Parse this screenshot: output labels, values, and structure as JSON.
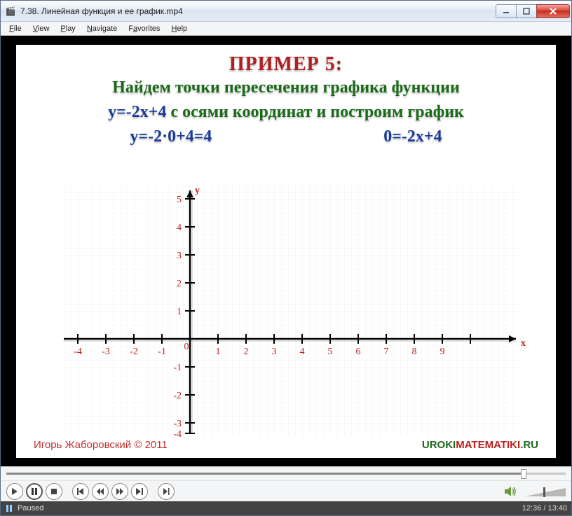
{
  "window": {
    "title": "7.38. Линейная функция и ее график.mp4"
  },
  "menu": {
    "file": "File",
    "view": "View",
    "play": "Play",
    "navigate": "Navigate",
    "favorites": "Favorites",
    "help": "Help"
  },
  "slide": {
    "title": "ПРИМЕР 5:",
    "line1_green": "Найдем точки пересечения графика функции",
    "line2_blue": "y=-2x+4",
    "line2_green": " с осями координат и построим график",
    "calc_left": "y=-2·0+4=4",
    "calc_right": "0=-2x+4",
    "author": "Игорь Жаборовский © 2011",
    "site_part1": "UROKI",
    "site_part2": "MATEMATIKI",
    "site_part3": ".RU"
  },
  "status": {
    "state": "Paused",
    "time": "12:36 / 13:40"
  },
  "chart_data": {
    "type": "line",
    "title": "",
    "xlabel": "x",
    "ylabel": "y",
    "x_ticks": [
      -4,
      -3,
      -2,
      -1,
      0,
      1,
      2,
      3,
      4,
      5,
      6,
      7,
      8,
      9
    ],
    "y_ticks": [
      -4,
      -3,
      -2,
      -1,
      1,
      2,
      3,
      4,
      5
    ],
    "xlim": [
      -5,
      10
    ],
    "ylim": [
      -4.5,
      5.5
    ],
    "series": [
      {
        "name": "y=-2x+4",
        "values": [],
        "note": "line not yet drawn in frame"
      }
    ]
  }
}
